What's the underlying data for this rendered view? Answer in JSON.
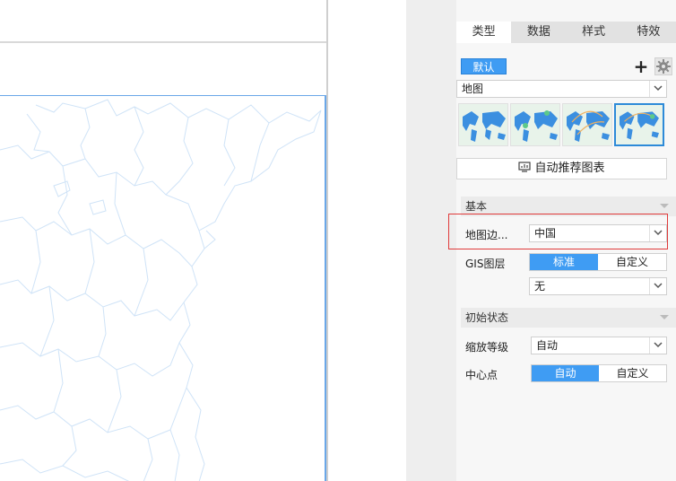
{
  "tabs": [
    {
      "label": "类型",
      "active": true
    },
    {
      "label": "数据",
      "active": false
    },
    {
      "label": "样式",
      "active": false
    },
    {
      "label": "特效",
      "active": false
    }
  ],
  "type_panel": {
    "default_label": "默认",
    "add_icon": "plus-icon",
    "settings_icon": "gear-icon",
    "chart_type_value": "地图",
    "thumbnails_selected_index": 3,
    "auto_recommend_label": "自动推荐图表"
  },
  "basic": {
    "section_label": "基本",
    "map_boundary_label": "地图边...",
    "map_boundary_value": "中国",
    "gis_label": "GIS图层",
    "gis_options": [
      "标准",
      "自定义"
    ],
    "gis_selected": "标准",
    "gis_layer_value": "无"
  },
  "initial_state": {
    "section_label": "初始状态",
    "zoom_label": "缩放等级",
    "zoom_value": "自动",
    "center_label": "中心点",
    "center_options": [
      "自动",
      "自定义"
    ],
    "center_selected": "自动"
  },
  "colors": {
    "accent": "#3f9cf3",
    "highlight_border": "#e03a3a",
    "map_line": "#cfe3f7"
  }
}
